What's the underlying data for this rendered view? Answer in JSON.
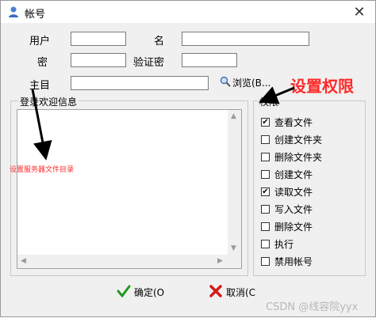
{
  "window": {
    "title": "帐号",
    "close_glyph": "✕"
  },
  "form": {
    "user_label": "用户",
    "name_label": "名",
    "password_label": "密",
    "confirm_password_label": "验证密",
    "home_dir_label": "主目",
    "browse_label": "浏览(B...",
    "user_value": "",
    "name_value": "",
    "password_value": "",
    "confirm_password_value": "",
    "home_dir_value": ""
  },
  "welcome": {
    "group_title": "登录欢迎信息",
    "text": ""
  },
  "permissions": {
    "group_title": "权限",
    "items": [
      {
        "label": "查看文件",
        "checked": true
      },
      {
        "label": "创建文件夹",
        "checked": false
      },
      {
        "label": "删除文件夹",
        "checked": false
      },
      {
        "label": "创建文件",
        "checked": false
      },
      {
        "label": "读取文件",
        "checked": true
      },
      {
        "label": "写入文件",
        "checked": false
      },
      {
        "label": "删除文件",
        "checked": false
      },
      {
        "label": "执行",
        "checked": false
      },
      {
        "label": "禁用帐号",
        "checked": false
      }
    ]
  },
  "buttons": {
    "ok_label": "确定(O",
    "cancel_label": "取消(C"
  },
  "annotations": {
    "permissions_note": "设置权限",
    "directory_note": "设置服务器文件目录",
    "color": "#ff2a2a"
  },
  "watermark": "CSDN @线容院yyx",
  "icons": {
    "title": "user-icon",
    "browse": "magnifier-icon",
    "ok": "green-check-icon",
    "cancel": "red-x-icon"
  }
}
